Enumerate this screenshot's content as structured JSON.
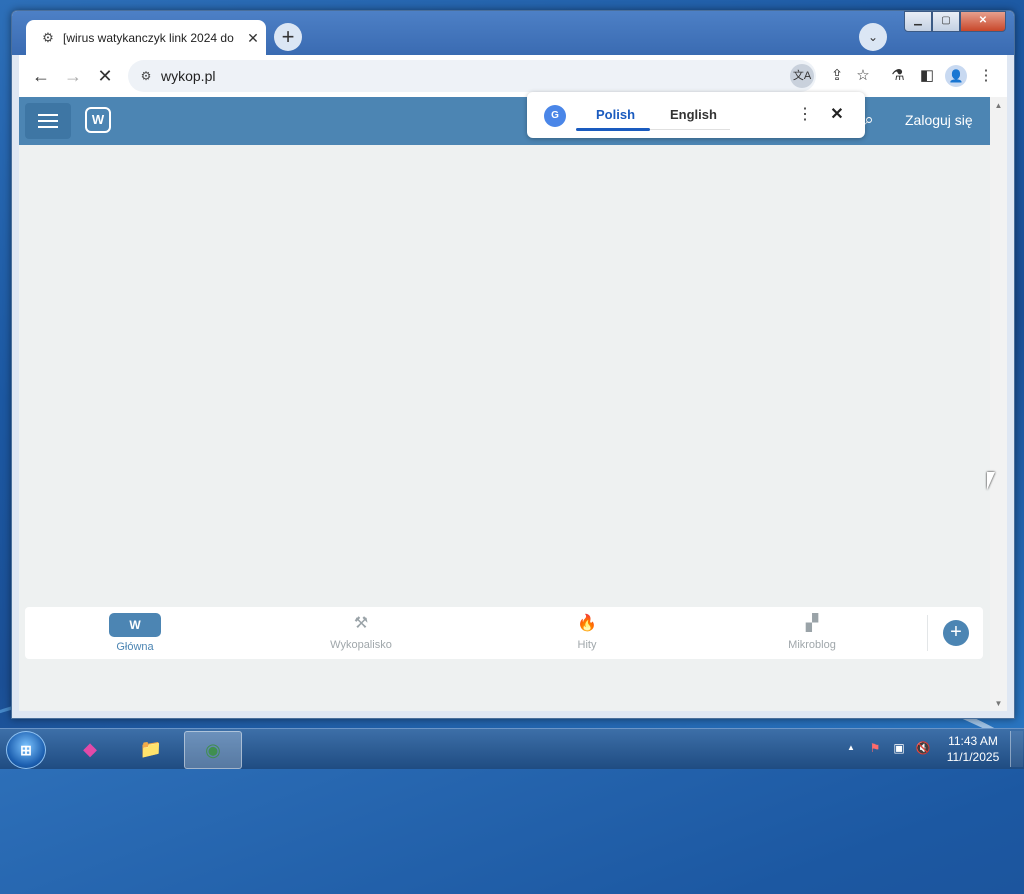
{
  "browser": {
    "tab": {
      "title": "[wirus watykanczyk link 2024 do",
      "favicon": "loading-icon"
    },
    "new_tab_label": "+",
    "tab_search_label": "⌄",
    "window_controls": {
      "minimize": "▁",
      "maximize": "▢",
      "close": "✕"
    },
    "address_url": "wykop.pl",
    "icons": {
      "back": "←",
      "forward": "→",
      "stop": "✕",
      "site_info": "⚙",
      "translate": "文A",
      "share": "⇪",
      "bookmark": "☆",
      "labs": "⚗",
      "side_panel": "◧",
      "profile": "👤",
      "menu": "⋮"
    }
  },
  "site": {
    "menu_icon": "hamburger-icon",
    "logo_text": "W",
    "search_icon": "⌕",
    "login_label": "Zaloguj się"
  },
  "translate_popup": {
    "icon_text": "G",
    "languages": [
      "Polish",
      "English"
    ],
    "active": "Polish",
    "more_label": "⋮",
    "close_label": "✕"
  },
  "bottom_nav": {
    "items": [
      {
        "label": "Główna",
        "icon": "W",
        "active": true
      },
      {
        "label": "Wykopalisko",
        "icon": "⚒",
        "active": false
      },
      {
        "label": "Hity",
        "icon": "🔥",
        "active": false
      },
      {
        "label": "Mikroblog",
        "icon": "▞",
        "active": false
      }
    ],
    "add_label": "+"
  },
  "taskbar": {
    "start_label": "⊞",
    "apps": [
      {
        "name": "app-icon",
        "glyph": "◆"
      },
      {
        "name": "file-explorer",
        "glyph": "📁"
      },
      {
        "name": "chrome",
        "glyph": "◉"
      }
    ],
    "tray": {
      "expand": "▲",
      "flag": "⚑",
      "network": "▣",
      "volume": "🔇"
    },
    "time": "11:43 AM",
    "date": "11/1/2025"
  },
  "colors": {
    "site_blue": "#4c85b3",
    "chrome_accent": "#1a5bbf"
  }
}
